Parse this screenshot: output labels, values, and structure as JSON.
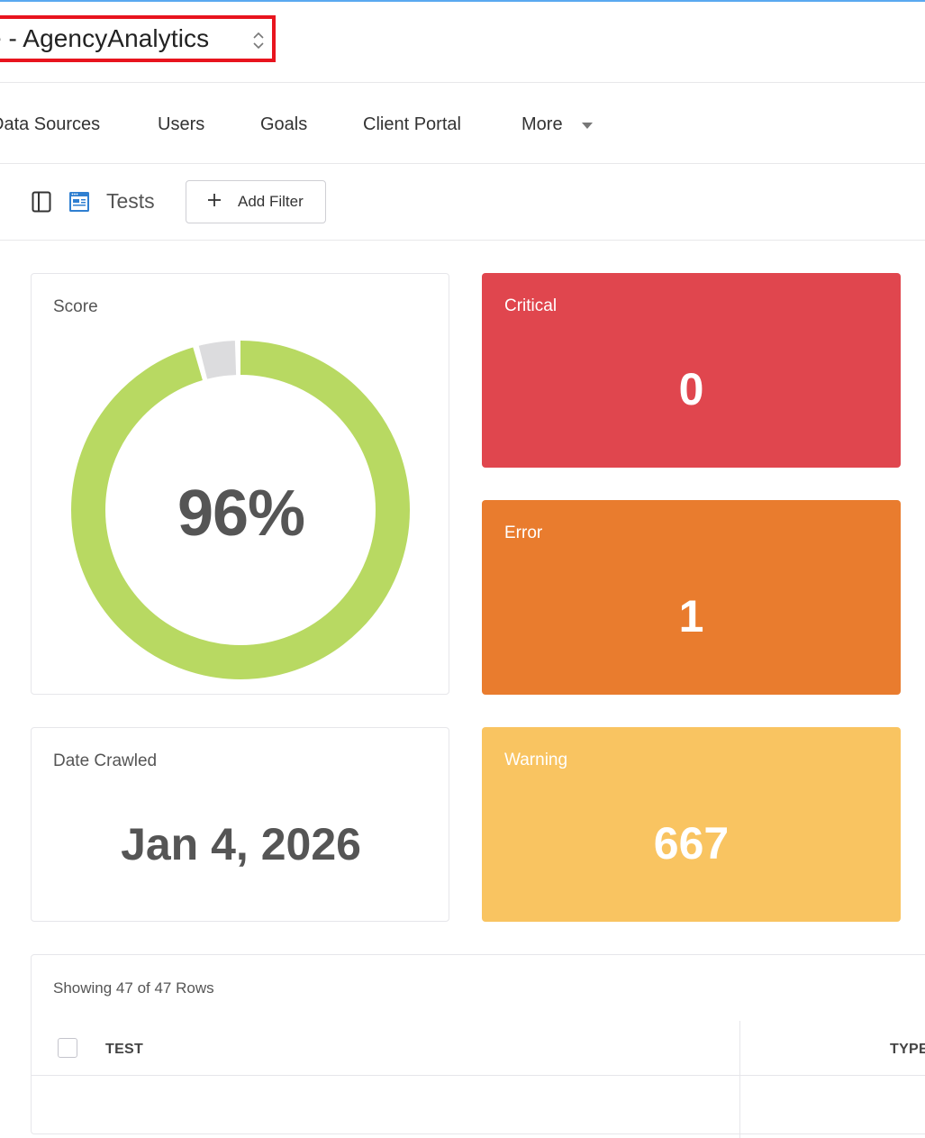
{
  "header": {
    "title": "e - AgencyAnalytics",
    "accent_color": "#e8141e"
  },
  "nav": {
    "items": [
      {
        "label": "Data Sources"
      },
      {
        "label": "Users"
      },
      {
        "label": "Goals"
      },
      {
        "label": "Client Portal"
      },
      {
        "label": "More"
      }
    ]
  },
  "toolbar": {
    "title": "Tests",
    "add_filter_label": "Add Filter"
  },
  "score": {
    "label": "Score",
    "value_text": "96%",
    "percent": 96,
    "fill_color": "#b8d962",
    "remainder_color": "#dcdcde"
  },
  "stats": {
    "critical": {
      "label": "Critical",
      "value": "0",
      "color": "#e0464e"
    },
    "error": {
      "label": "Error",
      "value": "1",
      "color": "#e97c2e"
    },
    "warning": {
      "label": "Warning",
      "value": "667",
      "color": "#f9c461"
    }
  },
  "date_crawled": {
    "label": "Date Crawled",
    "value": "Jan 4, 2026"
  },
  "table": {
    "rows_info": "Showing 47 of 47 Rows",
    "columns": [
      "TEST",
      "TYPE"
    ]
  }
}
